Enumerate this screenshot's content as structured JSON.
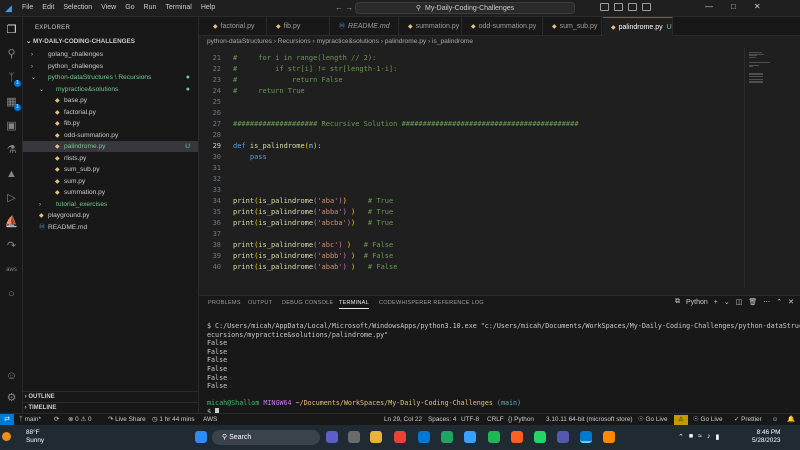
{
  "window": {
    "title": "My-Daily-Coding-Challenges",
    "menu": [
      "File",
      "Edit",
      "Selection",
      "View",
      "Go",
      "Run",
      "Terminal",
      "Help"
    ]
  },
  "explorer": {
    "header": "EXPLORER",
    "root": "MY-DAILY-CODING-CHALLENGES",
    "items": [
      {
        "label": "golang_challenges",
        "type": "folder",
        "indent": 1,
        "expanded": false
      },
      {
        "label": "python_challenges",
        "type": "folder",
        "indent": 1,
        "expanded": false
      },
      {
        "label": "python-dataStructures \\ Recursions",
        "type": "folder",
        "indent": 1,
        "expanded": true,
        "dot": "●"
      },
      {
        "label": "mypractice&solutions",
        "type": "folder",
        "indent": 2,
        "expanded": true,
        "dot": "●"
      },
      {
        "label": "base.py",
        "type": "py",
        "indent": 3
      },
      {
        "label": "factorial.py",
        "type": "py",
        "indent": 3
      },
      {
        "label": "fib.py",
        "type": "py",
        "indent": 3
      },
      {
        "label": "odd-summation.py",
        "type": "py",
        "indent": 3
      },
      {
        "label": "palindrome.py",
        "type": "py",
        "indent": 3,
        "active": true,
        "mark": "U"
      },
      {
        "label": "rlists.py",
        "type": "py",
        "indent": 3
      },
      {
        "label": "sum_sub.py",
        "type": "py",
        "indent": 3
      },
      {
        "label": "sum.py",
        "type": "py",
        "indent": 3
      },
      {
        "label": "summation.py",
        "type": "py",
        "indent": 3
      },
      {
        "label": "tutorial_exercises",
        "type": "folder",
        "indent": 2,
        "expanded": false
      },
      {
        "label": "playground.py",
        "type": "py",
        "indent": 1
      },
      {
        "label": "README.md",
        "type": "md",
        "indent": 1
      }
    ],
    "outline": "OUTLINE",
    "timeline": "TIMELINE"
  },
  "tabs": [
    {
      "label": "factorial.py",
      "width": 62
    },
    {
      "label": "fib.py",
      "width": 62
    },
    {
      "label": "README.md",
      "width": 68
    },
    {
      "label": "summation.py",
      "width": 62
    },
    {
      "label": "odd-summation.py",
      "width": 80
    },
    {
      "label": "sum_sub.py",
      "width": 58
    },
    {
      "label": "palindrome.py",
      "width": 70,
      "active": true,
      "mark": "U"
    }
  ],
  "breadcrumb": "python-dataStructures › Recursions › mypractice&solutions ›  palindrome.py ›  is_palindrome",
  "editor": {
    "current_line": 29,
    "lines": [
      {
        "n": 21,
        "html": "<span class='cm'>#     for i in range(length // 2):</span>"
      },
      {
        "n": 22,
        "html": "<span class='cm'>#         if str[i] != str[length-1-i]:</span>"
      },
      {
        "n": 23,
        "html": "<span class='cm'>#             return False</span>"
      },
      {
        "n": 24,
        "html": "<span class='cm'>#     return True</span>"
      },
      {
        "n": 25,
        "html": ""
      },
      {
        "n": 26,
        "html": ""
      },
      {
        "n": 27,
        "html": "<span class='cm'>#################### Recursive Solution ##########################################</span>"
      },
      {
        "n": 28,
        "html": ""
      },
      {
        "n": 29,
        "html": "<span class='kw'>def</span> <span class='fn'>is_palindrome</span><span class='br1'>(</span><span class='pa'>n</span><span class='br1'>)</span>:"
      },
      {
        "n": 30,
        "html": "    <span class='kw'>pass</span>"
      },
      {
        "n": 31,
        "html": ""
      },
      {
        "n": 32,
        "html": ""
      },
      {
        "n": 33,
        "html": ""
      },
      {
        "n": 34,
        "html": "<span class='fn'>print</span><span class='br1'>(</span><span class='fn'>is_palindrome</span><span class='br2'>(</span><span class='st'>'aba'</span><span class='br2'>)</span><span class='br1'>)</span>     <span class='cm'># True</span>"
      },
      {
        "n": 35,
        "html": "<span class='fn'>print</span><span class='br1'>(</span><span class='fn'>is_palindrome</span><span class='br2'>(</span><span class='st'>'abba'</span><span class='br2'>)</span> <span class='br1'>)</span>   <span class='cm'># True</span>"
      },
      {
        "n": 36,
        "html": "<span class='fn'>print</span><span class='br1'>(</span><span class='fn'>is_palindrome</span><span class='br2'>(</span><span class='st'>'abcba'</span><span class='br2'>)</span><span class='br1'>)</span>   <span class='cm'># True</span>"
      },
      {
        "n": 37,
        "html": ""
      },
      {
        "n": 38,
        "html": "<span class='fn'>print</span><span class='br1'>(</span><span class='fn'>is_palindrome</span><span class='br2'>(</span><span class='st'>'abc'</span><span class='br2'>)</span> <span class='br1'>)</span>   <span class='cm'># False</span>"
      },
      {
        "n": 39,
        "html": "<span class='fn'>print</span><span class='br1'>(</span><span class='fn'>is_palindrome</span><span class='br2'>(</span><span class='st'>'abbb'</span><span class='br2'>)</span> <span class='br1'>)</span>  <span class='cm'># False</span>"
      },
      {
        "n": 40,
        "html": "<span class='fn'>print</span><span class='br1'>(</span><span class='fn'>is_palindrome</span><span class='br2'>(</span><span class='st'>'abab'</span><span class='br2'>)</span> <span class='br1'>)</span>   <span class='cm'># False</span>"
      }
    ]
  },
  "panel": {
    "tabs": [
      "PROBLEMS",
      "OUTPUT",
      "DEBUG CONSOLE",
      "TERMINAL",
      "CODEWHISPERER REFERENCE LOG"
    ],
    "active_tab": "TERMINAL",
    "shell": "Python"
  },
  "terminal": {
    "command": "$ C:/Users/micah/AppData/Local/Microsoft/WindowsApps/python3.10.exe \"c:/Users/micah/Documents/WorkSpaces/My-Daily-Coding-Challenges/python-dataStructures/R\necursions/mypractice&solutions/palindrome.py\"",
    "output": [
      "False",
      "False",
      "False",
      "False",
      "False",
      "False"
    ],
    "prompt_user": "micah@Shallom",
    "prompt_host": "MINGW64",
    "prompt_path": "~/Documents/WorkSpaces/My-Daily-Coding-Challenges",
    "prompt_branch": "(main)",
    "prompt_symbol": "$"
  },
  "status": {
    "branch": "main*",
    "sync": "⟳",
    "errors": "⊗ 0 ⚠ 0",
    "liveshare": "Live Share",
    "time": "1 hr 44 mins",
    "aws": "AWS",
    "position": "Ln 29, Col 22",
    "spaces": "Spaces: 4",
    "encoding": "UTF-8",
    "eol": "CRLF",
    "language": "Python",
    "interpreter": "3.10.11 64-bit (microsoft store)",
    "golive1": "Go Live",
    "golive2": "Go Live",
    "prettier": "Prettier"
  },
  "taskbar": {
    "temp": "88°F",
    "weather": "Sunny",
    "search": "Search",
    "time": "8:46 PM",
    "date": "5/28/2023"
  },
  "colors": {
    "accent": "#0078d4",
    "editor_bg": "#1f1f1f",
    "sidebar_bg": "#181818",
    "taskbar_bg": "#202a33"
  }
}
